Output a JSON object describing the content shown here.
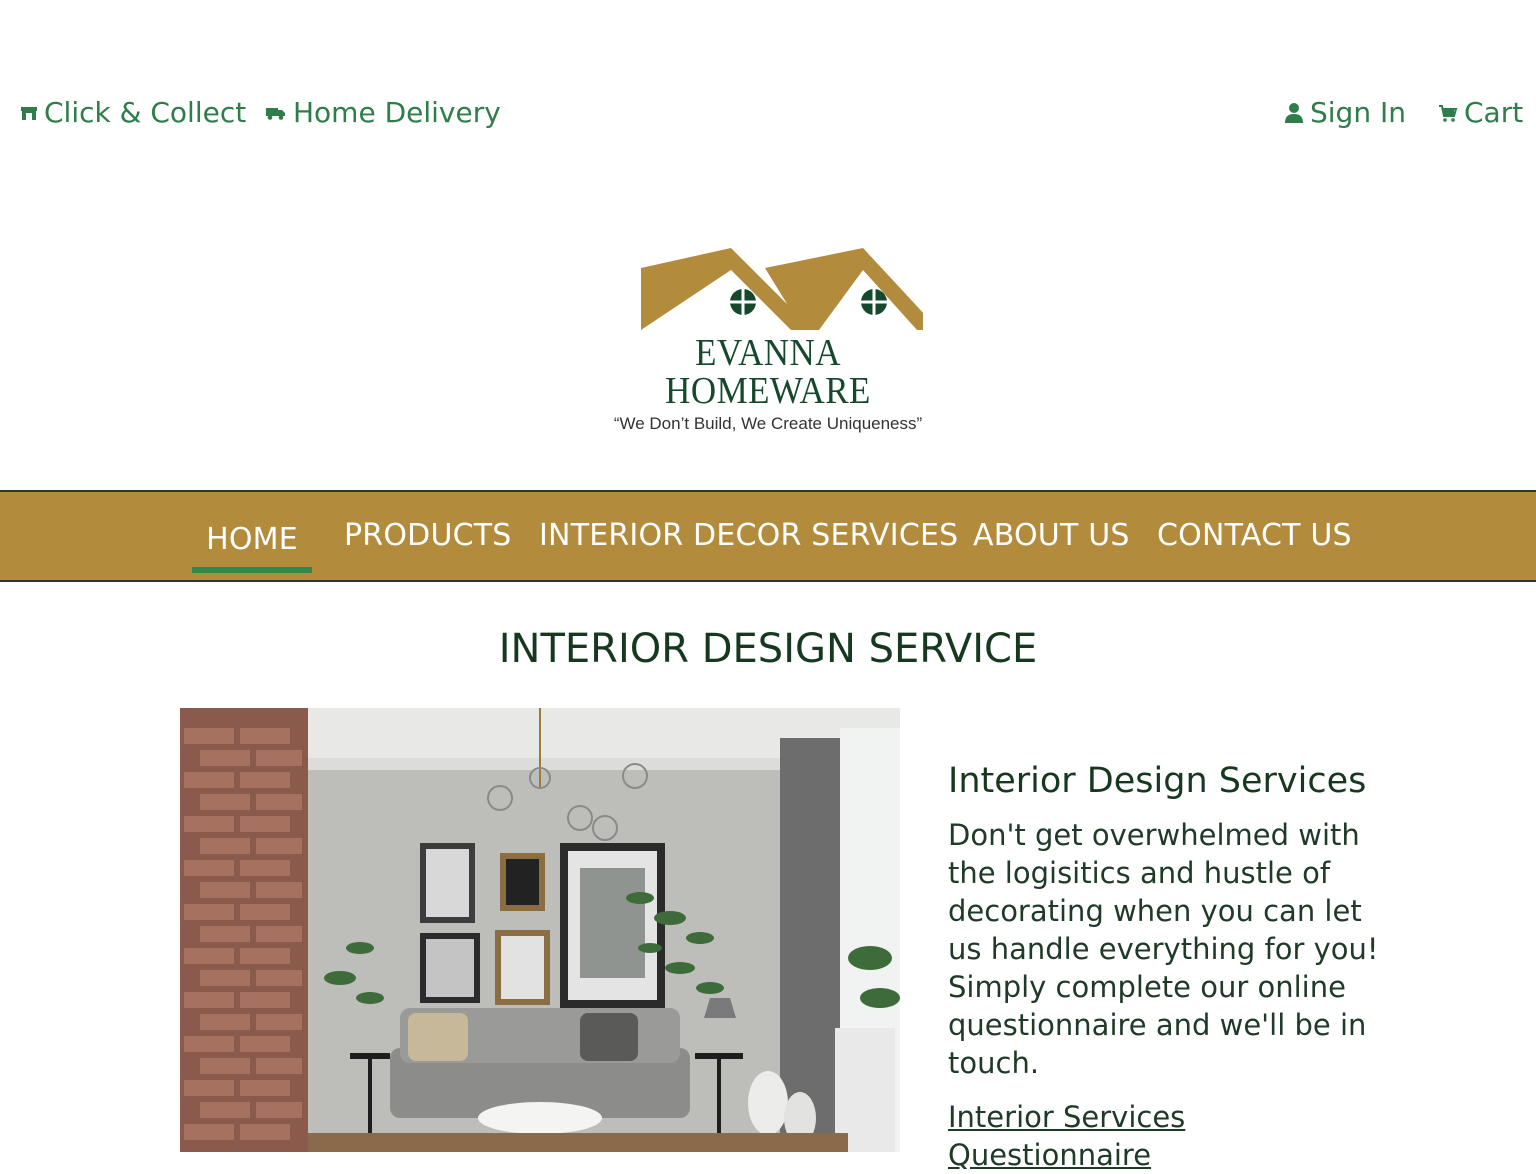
{
  "topbar": {
    "click_collect": "Click & Collect",
    "home_delivery": "Home Delivery",
    "sign_in": "Sign In",
    "cart": "Cart"
  },
  "logo": {
    "name": "EVANNA HOMEWARE",
    "tagline": "“We Don’t Build, We Create Uniqueness”"
  },
  "nav": {
    "items": [
      {
        "label": "HOME",
        "active": true
      },
      {
        "label": "PRODUCTS"
      },
      {
        "label": "INTERIOR DECOR SERVICES"
      },
      {
        "label": "ABOUT US"
      },
      {
        "label": "CONTACT US"
      }
    ]
  },
  "main": {
    "title": "INTERIOR DESIGN SERVICE",
    "section_heading": "Interior Design Services",
    "section_body": "Don't get overwhelmed with the logisitics and hustle of decorating when you can let us handle everything for you! Simply complete our online questionnaire and we'll be in touch.",
    "link_label": "Interior Services Questionnaire"
  },
  "colors": {
    "brand_green": "#2e7d4a",
    "dark_green": "#16381f",
    "gold": "#b38b3d",
    "nav_text": "#ffffff"
  },
  "icons": {
    "click_collect": "store-icon",
    "home_delivery": "truck-icon",
    "sign_in": "user-icon",
    "cart": "cart-icon"
  }
}
